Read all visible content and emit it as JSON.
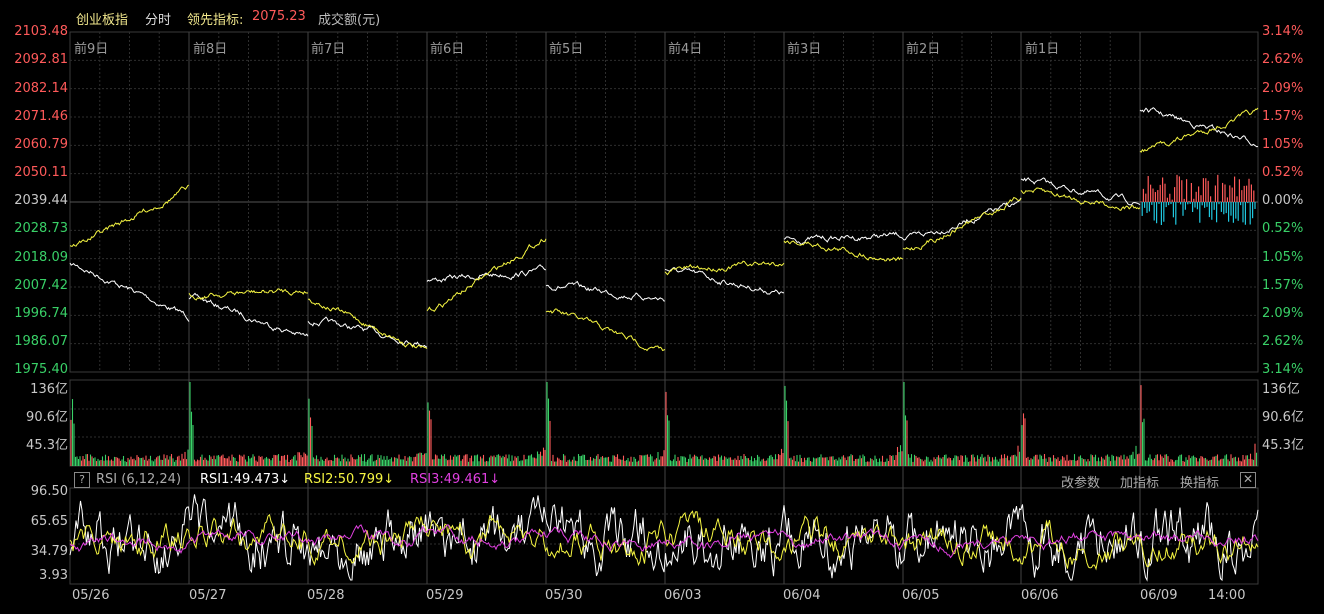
{
  "header": {
    "index_name": "创业板指",
    "mode": "分时",
    "leading_label": "领先指标:",
    "leading_value": "2075.23",
    "volume_label": "成交额(元)"
  },
  "price_axis": {
    "left_labels": [
      "2103.48",
      "2092.81",
      "2082.14",
      "2071.46",
      "2060.79",
      "2050.11",
      "2039.44",
      "2028.73",
      "2018.09",
      "2007.42",
      "1996.74",
      "1986.07",
      "1975.40"
    ],
    "right_labels": [
      "3.14%",
      "2.62%",
      "2.09%",
      "1.57%",
      "1.05%",
      "0.52%",
      "0.00%",
      "0.52%",
      "1.05%",
      "1.57%",
      "2.09%",
      "2.62%",
      "3.14%"
    ]
  },
  "day_labels": [
    "前9日",
    "前8日",
    "前7日",
    "前6日",
    "前5日",
    "前4日",
    "前3日",
    "前2日",
    "前1日"
  ],
  "volume_axis": {
    "labels": [
      "136亿",
      "90.6亿",
      "45.3亿"
    ]
  },
  "rsi": {
    "help": "?",
    "title": "RSI (6,12,24)",
    "rsi1": "RSI1:49.473↓",
    "rsi2": "RSI2:50.799↓",
    "rsi3": "RSI3:49.461↓",
    "btn_params": "改参数",
    "btn_add": "加指标",
    "btn_switch": "换指标",
    "close": "✕",
    "axis_labels": [
      "96.50",
      "65.65",
      "34.79",
      "3.93"
    ]
  },
  "x_dates": [
    "05/26",
    "05/27",
    "05/28",
    "05/29",
    "05/30",
    "06/03",
    "06/04",
    "06/05",
    "06/06",
    "06/09",
    "14:00"
  ],
  "colors": {
    "up": "#ff5a5a",
    "down": "#39d067",
    "index_line": "#ffffff",
    "leading_line": "#f5f542",
    "rsi1": "#ffffff",
    "rsi2": "#f5f542",
    "rsi3": "#e040e0",
    "grid": "#2e2e2e",
    "volume_neg": "#20c8e0"
  }
}
